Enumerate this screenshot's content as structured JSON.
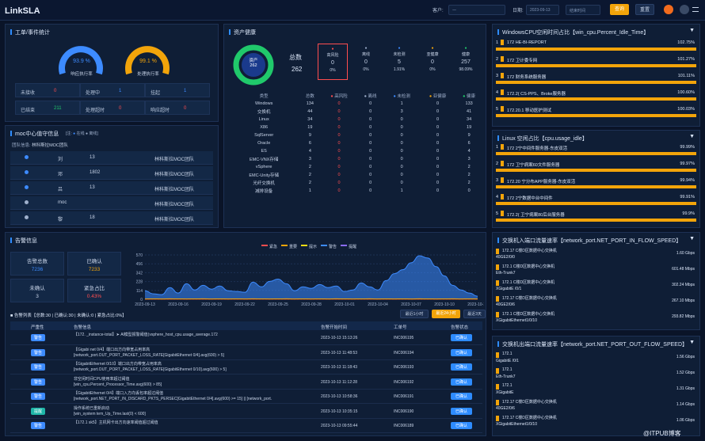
{
  "header": {
    "logo": "LinkSLA",
    "customer_label": "客户:",
    "customer_value": "一",
    "date_label": "日期:",
    "date_from": "2023-09-13",
    "date_to": "结束时间",
    "query": "查询",
    "reset": "重置"
  },
  "workorder": {
    "title": "工单/事件统计",
    "g1_value": "93.9 %",
    "g1_label": "响应执行率",
    "g1_pct": 93.9,
    "g2_value": "99.1 %",
    "g2_label": "处理执行率",
    "g2_pct": 99.1,
    "cells": [
      {
        "k": "未接收",
        "v": "0"
      },
      {
        "k": "处理中",
        "v": "1"
      },
      {
        "k": "挂起",
        "v": "1"
      },
      {
        "k": "已结束",
        "v": "211"
      },
      {
        "k": "处理超时",
        "v": "0"
      },
      {
        "k": "响应超时",
        "v": "0"
      }
    ]
  },
  "moc": {
    "title": "moc中心值守信息",
    "legend_label": "[注:",
    "online": "在线",
    "offline": "离线",
    "team_label": "团队信息:",
    "team": "林科斯拉MOC团队",
    "rows": [
      {
        "name": "刘",
        "phone": "13",
        "team": "林科斯拉MOC团队",
        "online": true
      },
      {
        "name": "邓",
        "phone": "1802",
        "team": "林科斯拉MOC团队",
        "online": true
      },
      {
        "name": "吕",
        "phone": "13",
        "team": "林科斯拉MOC团队",
        "online": true
      },
      {
        "name": "moc",
        "phone": "",
        "team": "林科斯拉MOC团队",
        "online": false
      },
      {
        "name": "黎",
        "phone": "18",
        "team": "林科斯拉MOC团队",
        "online": false
      }
    ]
  },
  "assets": {
    "title": "资产健康",
    "donut_label": "资产",
    "donut_value": "262",
    "total_label": "总数",
    "total_value": "262",
    "stats": [
      {
        "label": "高风险",
        "value": "0",
        "pct": "0%",
        "color": "#ff4d4f"
      },
      {
        "label": "离线",
        "value": "0",
        "pct": "0%",
        "color": "#9fb0cc"
      },
      {
        "label": "未检测",
        "value": "5",
        "pct": "1.91%",
        "color": "#3d8bff"
      },
      {
        "label": "亚健康",
        "value": "0",
        "pct": "0%",
        "color": "#f2a40a"
      },
      {
        "label": "健康",
        "value": "257",
        "pct": "98.09%",
        "color": "#20c96b"
      }
    ],
    "headers": [
      "类型",
      "总数",
      "高风险",
      "离线",
      "未检测",
      "亚健康",
      "健康"
    ],
    "rows": [
      [
        "Windows",
        "134",
        "0",
        "0",
        "1",
        "0",
        "133"
      ],
      [
        "交换机",
        "44",
        "0",
        "0",
        "3",
        "0",
        "41"
      ],
      [
        "Linux",
        "34",
        "0",
        "0",
        "0",
        "0",
        "34"
      ],
      [
        "X86",
        "19",
        "0",
        "0",
        "0",
        "0",
        "19"
      ],
      [
        "SqlServer",
        "9",
        "0",
        "0",
        "0",
        "0",
        "9"
      ],
      [
        "Oracle",
        "6",
        "0",
        "0",
        "0",
        "0",
        "6"
      ],
      [
        "ES",
        "4",
        "0",
        "0",
        "0",
        "0",
        "4"
      ],
      [
        "EMC-VNX存储",
        "3",
        "0",
        "0",
        "0",
        "0",
        "3"
      ],
      [
        "vSphere",
        "2",
        "0",
        "0",
        "0",
        "0",
        "2"
      ],
      [
        "EMC-Unity存储",
        "2",
        "0",
        "0",
        "0",
        "0",
        "2"
      ],
      [
        "光纤交换机",
        "2",
        "0",
        "0",
        "0",
        "0",
        "2"
      ],
      [
        "减排设备",
        "1",
        "0",
        "0",
        "1",
        "0",
        "0"
      ]
    ]
  },
  "cpu_win": {
    "title": "WindowsCPU空闲时间占比【win_cpu.Percent_Idle_Time】",
    "items": [
      {
        "n": "1",
        "label": "172   HE-BI-REPORT",
        "value": "102.75%",
        "pct": 100
      },
      {
        "n": "2",
        "label": "172   卫计委专网",
        "value": "101.27%",
        "pct": 100
      },
      {
        "n": "3",
        "label": "172   财务系统服务器",
        "value": "101.11%",
        "pct": 100
      },
      {
        "n": "4",
        "label": "172.2(   CS-PPS、Broke服务器",
        "value": "100.60%",
        "pct": 100
      },
      {
        "n": "5",
        "label": "172.20.1   移动医护测试",
        "value": "100.03%",
        "pct": 100
      }
    ]
  },
  "cpu_linux": {
    "title": "Linux   空闲占比【cpu.usage_idle】",
    "items": [
      {
        "n": "1",
        "label": "172   2宁中间件服务器-东皮双活",
        "value": "99.99%",
        "pct": 99.99
      },
      {
        "n": "2",
        "label": "172   卫宁病案60文件服务器",
        "value": "99.97%",
        "pct": 99.97
      },
      {
        "n": "3",
        "label": "172.20   宁分布APP服务器-东皮双活",
        "value": "99.94%",
        "pct": 99.94
      },
      {
        "n": "4",
        "label": "172   2宁数据中台中间件",
        "value": "99.91%",
        "pct": 99.91
      },
      {
        "n": "5",
        "label": "172.2(   卫宁病案80后台服务器",
        "value": "99.9%",
        "pct": 99.9
      }
    ]
  },
  "net_in": {
    "title": "交换机入端口流量速率【network_port.NET_PORT_IN_FLOW_SPEED】",
    "items": [
      {
        "l1": "172.17   C楼D区数据中心交换机",
        "l2": "40GE2/0/0",
        "value": "1.60 Gbps"
      },
      {
        "l1": "172.1   C楼D区数据中心交换机",
        "l2": "Eth-Trunk7",
        "value": "601.48 Mbps"
      },
      {
        "l1": "172.1   C楼D区数据中心交换机",
        "l2": "XGigabitE   /0/1",
        "value": "302.24 Mbps"
      },
      {
        "l1": "172.17   C楼D区数据中心交换机",
        "l2": "40GE2/0/6",
        "value": "267.10 Mbps"
      },
      {
        "l1": "172.1   C楼D区数据中心交换机",
        "l2": "XGigabitEthernet1/0/10",
        "value": "293.82 Mbps"
      }
    ]
  },
  "net_out": {
    "title": "交换机出端口流量速率【network_port.NET_PORT_OUT_FLOW_SPEED】",
    "items": [
      {
        "l1": "172.1",
        "l2": "GigabitE   /0/1",
        "value": "1.56 Gbps"
      },
      {
        "l1": "172.1",
        "l2": "Eth-Trunk7",
        "value": "1.52 Gbps"
      },
      {
        "l1": "172.1",
        "l2": "XGigabitE",
        "value": "1.31 Gbps"
      },
      {
        "l1": "172.17   C楼D区数据中心交换机",
        "l2": "40GE2/0/6",
        "value": "1.14 Gbps"
      },
      {
        "l1": "172.17   C楼D区数据中心交换机",
        "l2": "XGigabitEthernet1/0/10",
        "value": "1.06 Gbps"
      }
    ]
  },
  "alarm": {
    "title": "告警信息",
    "total_label": "告警总数",
    "total": "7236",
    "confirmed_label": "已确认",
    "confirmed": "7233",
    "unconfirmed_label": "未确认",
    "unconfirmed": "3",
    "urgent_label": "紧急占比",
    "urgent": "0.43%",
    "legend": [
      "紧急",
      "重要",
      "提示",
      "警告",
      "提醒"
    ],
    "legend_colors": [
      "#ff4d4f",
      "#f2a40a",
      "#fadb14",
      "#3d8bff",
      "#8a6cff"
    ],
    "stats_line": "■ 告警列表【总数:30 | 已确认:30 | 未确认:0 | 紧急占比:0%】",
    "filters": [
      "最近1小时",
      "最近24小时",
      "最近3天"
    ],
    "headers": [
      "严重性",
      "告警信息",
      "告警开始时间",
      "工单号",
      "告警状态"
    ],
    "rows": [
      {
        "sev": "警告",
        "sevc": "#3d8bff",
        "msg": "【172.      _instance-total】➤ Al模型报警阈值(vsphere_host_cpu.usage_average.172",
        "msg2": "",
        "time": "2023-10-13 15:13:26",
        "id": "INC006195",
        "status": "已确认"
      },
      {
        "sev": "警告",
        "sevc": "#3d8bff",
        "msg": "【Gigabi   net 0/4】端口出方向带宽占用率高",
        "msg2": "[network_port.OUT_PORT_PACKET_LOSS_RATE[GigabitEthernet 0/4].avg(600) > 5]",
        "time": "2023-10-13 11:48:53",
        "id": "INC006194",
        "status": "已确认"
      },
      {
        "sev": "警告",
        "sevc": "#3d8bff",
        "msg": "【GigabitEthernet 0/10】端口出方向带宽占用率高",
        "msg2": "[network_port.OUT_PORT_PACKET_LOSS_RATE[GigabitEthernet 0/10].avg(600) > 5]",
        "time": "2023-10-13 11:18:43",
        "id": "INC006193",
        "status": "已确认"
      },
      {
        "sev": "警告",
        "sevc": "#3d8bff",
        "msg": "非空闲时间CPU使用率超过阈值",
        "msg2": "[win_cpu.Percent_Processor_Time.avg(600) > 85]",
        "time": "2023-10-13 11:12:28",
        "id": "INC006192",
        "status": "已确认"
      },
      {
        "sev": "警告",
        "sevc": "#3d8bff",
        "msg": "【GigabitEthernet 0/4】端口入方向丢包率超过阈值",
        "msg2": "[network_port.NET_PORT_IN_DISCARD_PKTS_PERSEC[GigabitEthernet 0/4].avg(600) >= 15] || [network_port.",
        "time": "2023-10-13 10:58:36",
        "id": "INC006191",
        "status": "已确认"
      },
      {
        "sev": "提醒",
        "sevc": "#1fb6a8",
        "msg": "操作系统已重新启动",
        "msg2": "[win_system   tem_Up_Time.last(0) < 600]",
        "time": "2023-10-13 10:35:15",
        "id": "INC006190",
        "status": "已确认"
      },
      {
        "sev": "警告",
        "sevc": "#3d8bff",
        "msg": "【172.1   sk5】主机网卡出方向速率阈值超过阈值",
        "msg2": "",
        "time": "2023-10-13 09:55:44",
        "id": "INC006189",
        "status": "已确认"
      }
    ]
  },
  "chart_data": {
    "type": "area",
    "title": "",
    "ylim": [
      0,
      570
    ],
    "yticks": [
      "570",
      "456",
      "342",
      "228",
      "114",
      "0"
    ],
    "categories": [
      "2023-09-13",
      "2023-09-16",
      "2023-09-19",
      "2023-09-22",
      "2023-09-25",
      "2023-09-28",
      "2023-10-01",
      "2023-10-04",
      "2023-10-07",
      "2023-10-10",
      "2023-10-13"
    ],
    "series": [
      {
        "name": "警告",
        "color": "#3d8bff",
        "values": [
          110,
          70,
          60,
          150,
          80,
          200,
          120,
          180,
          130,
          170,
          110,
          100,
          90,
          220,
          160,
          230,
          260,
          200,
          110,
          160,
          140,
          190,
          150,
          170,
          100,
          120,
          210,
          160,
          120,
          240,
          330,
          380,
          470,
          560,
          530,
          420,
          300,
          180,
          120,
          80,
          40
        ]
      },
      {
        "name": "紧急",
        "color": "#ff4d4f",
        "values": [
          2,
          2,
          2,
          3,
          2,
          2,
          2,
          3,
          2,
          2,
          2,
          2,
          2,
          3,
          2,
          2,
          2,
          2,
          2,
          2,
          2,
          2,
          2,
          2,
          2,
          2,
          3,
          2,
          2,
          2,
          3,
          2,
          2,
          3,
          2,
          2,
          2,
          2,
          2,
          2,
          2
        ]
      },
      {
        "name": "重要",
        "color": "#f2a40a",
        "values": [
          4,
          5,
          4,
          6,
          5,
          4,
          5,
          6,
          4,
          5,
          4,
          5,
          4,
          6,
          5,
          4,
          5,
          6,
          4,
          5,
          4,
          5,
          4,
          6,
          5,
          4,
          5,
          6,
          4,
          5,
          4,
          5,
          4,
          6,
          5,
          4,
          5,
          6,
          4,
          5,
          4
        ]
      }
    ]
  },
  "footer": {
    "watermark": "@ITPUB博客"
  }
}
